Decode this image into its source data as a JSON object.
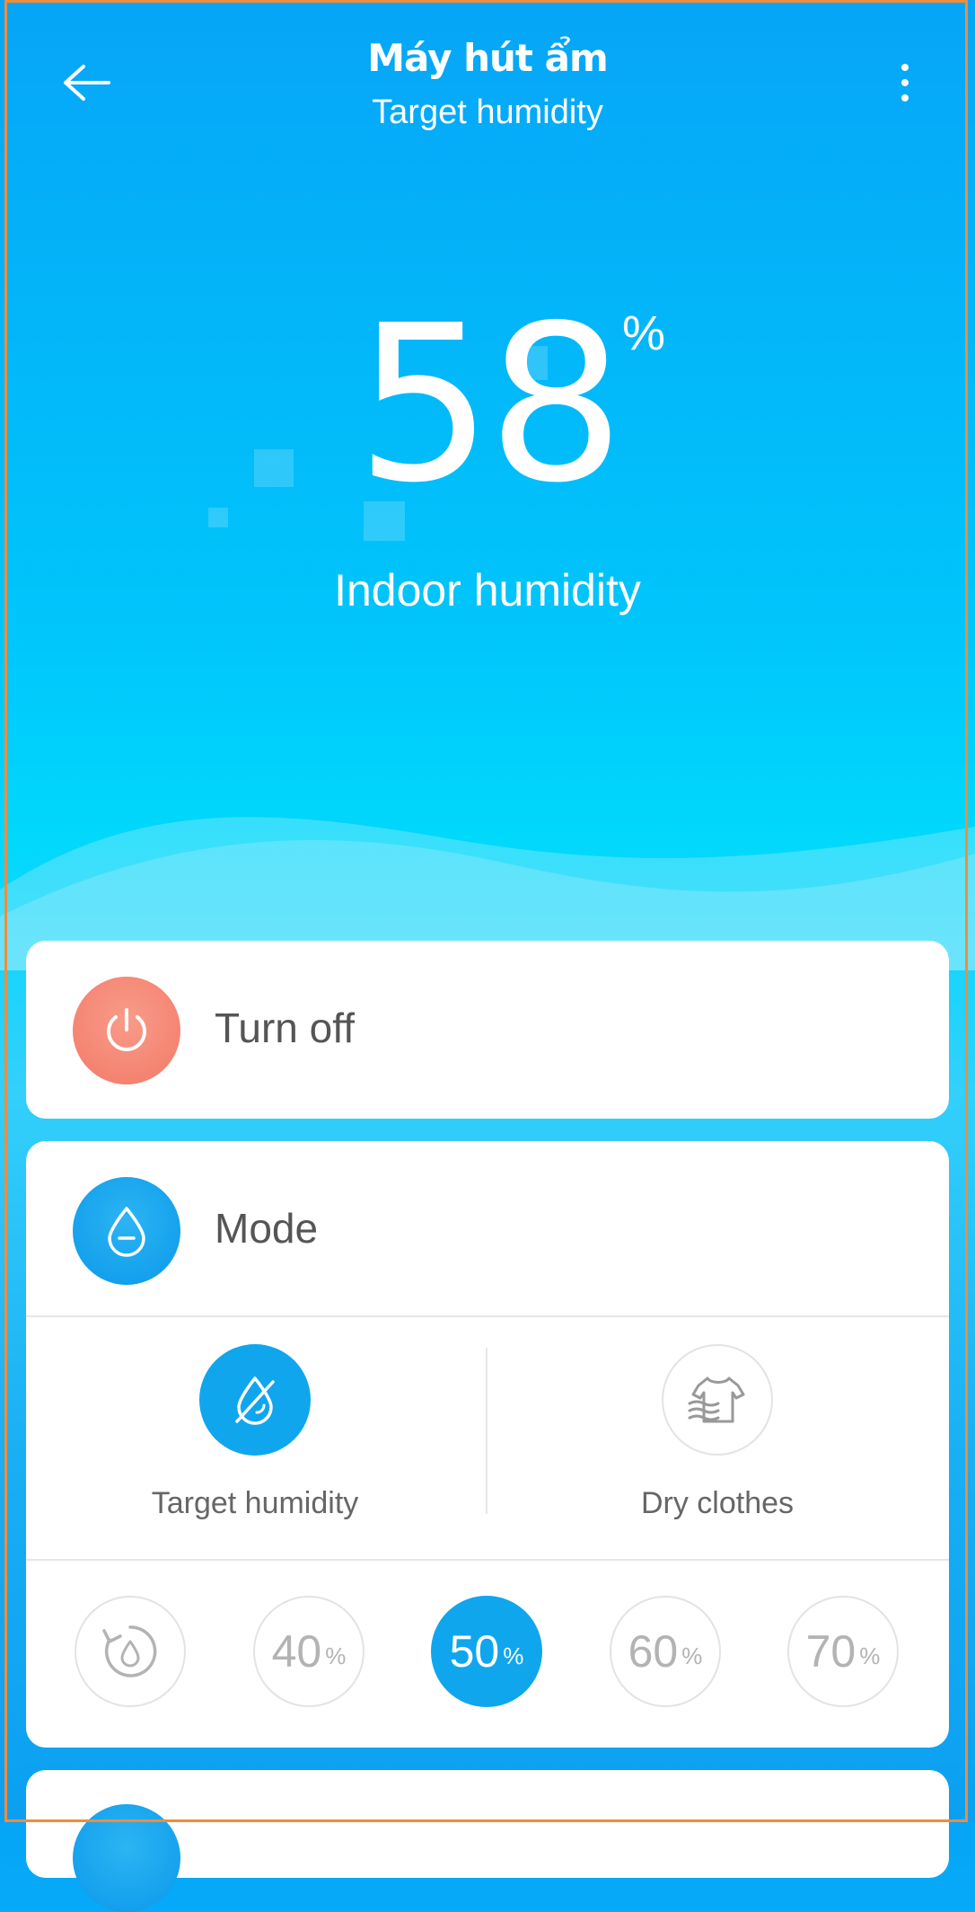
{
  "header": {
    "title": "Máy hút ẩm",
    "subtitle": "Target humidity"
  },
  "humidity": {
    "value": "58",
    "unit": "%",
    "label": "Indoor humidity"
  },
  "power": {
    "label": "Turn off",
    "icon": "power-icon",
    "color": "#f47d68"
  },
  "mode": {
    "label": "Mode",
    "icon": "droplet-icon",
    "options": [
      {
        "label": "Target humidity",
        "icon": "humidity-off-icon",
        "selected": true
      },
      {
        "label": "Dry clothes",
        "icon": "shirt-dry-icon",
        "selected": false
      }
    ]
  },
  "target_levels": {
    "unit": "%",
    "options": [
      {
        "value": "",
        "icon": "auto-cycle-icon"
      },
      {
        "value": "40"
      },
      {
        "value": "50",
        "selected": true
      },
      {
        "value": "60"
      },
      {
        "value": "70"
      }
    ]
  },
  "colors": {
    "accent": "#0fa6ee",
    "power": "#f47d68",
    "frame": "#f28c3a"
  }
}
